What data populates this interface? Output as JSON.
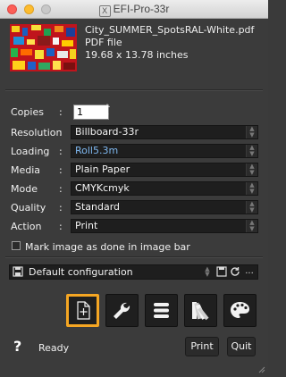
{
  "window": {
    "title": "EFI-Pro-33r"
  },
  "file": {
    "name": "City_SUMMER_SpotsRAL-White.pdf",
    "type": "PDF file",
    "size": "19.68 x 13.78 inches"
  },
  "form": {
    "copies": {
      "label": "Copies",
      "value": "1"
    },
    "resolution": {
      "label": "Resolution",
      "value": "Billboard-33r"
    },
    "loading": {
      "label": "Loading",
      "value": "Roll5.3m"
    },
    "media": {
      "label": "Media",
      "value": "Plain Paper"
    },
    "mode": {
      "label": "Mode",
      "value": "CMYKcmyk"
    },
    "quality": {
      "label": "Quality",
      "value": "Standard"
    },
    "action": {
      "label": "Action",
      "value": "Print"
    },
    "colon": ":",
    "mark_label": "Mark image as done in image bar",
    "mark_checked": false
  },
  "configuration": {
    "value": "Default configuration",
    "more": "..."
  },
  "toolbar": {
    "items": [
      "document-icon",
      "wrench-icon",
      "list-icon",
      "swatch-fan-icon",
      "palette-icon"
    ],
    "active_index": 0
  },
  "footer": {
    "help": "?",
    "status": "Ready",
    "print_label": "Print",
    "quit_label": "Quit"
  },
  "colors": {
    "accent": "#f5a623",
    "field_bg": "#1e1e1e",
    "window_bg": "#3b3b3b",
    "blue_value": "#7fb8f0"
  }
}
